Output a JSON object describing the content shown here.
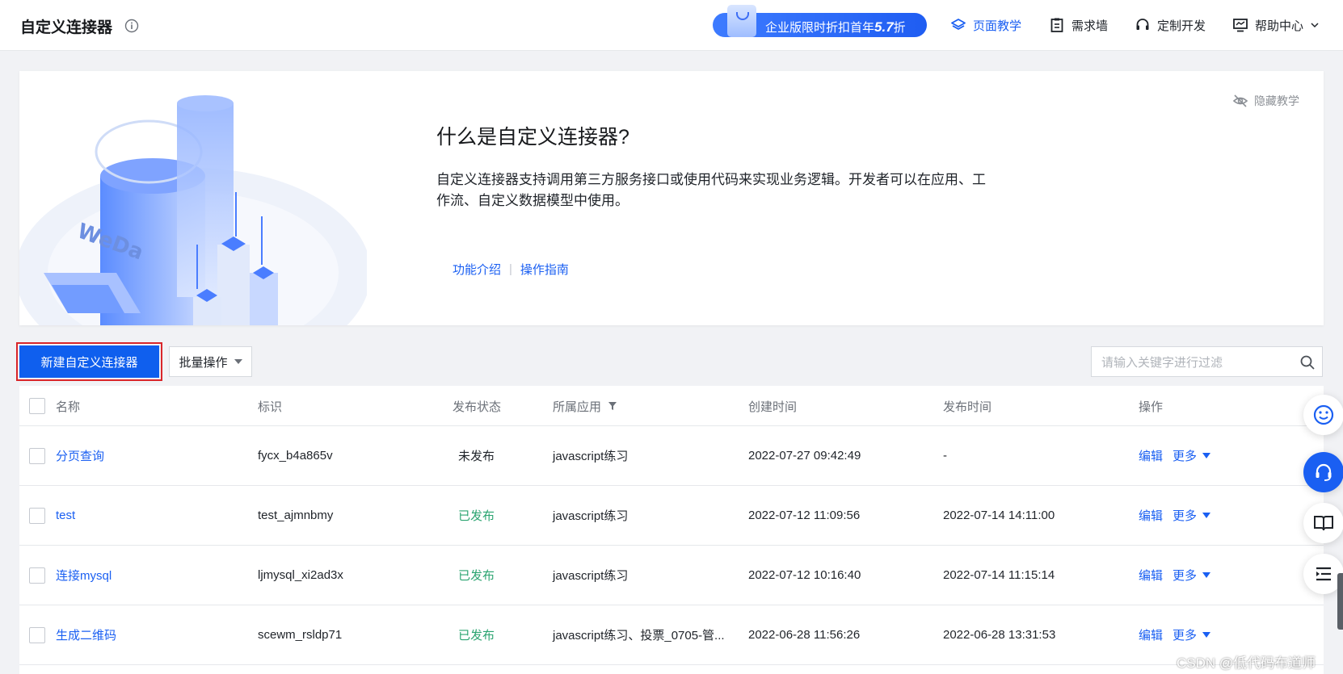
{
  "header": {
    "title": "自定义连接器",
    "promo": {
      "text": "企业版限时折扣首年",
      "number": "5.7",
      "suffix": "折"
    },
    "nav": [
      {
        "label": "页面教学",
        "icon": "layers-icon",
        "active": true
      },
      {
        "label": "需求墙",
        "icon": "clipboard-icon",
        "active": false
      },
      {
        "label": "定制开发",
        "icon": "headset-icon",
        "active": false
      },
      {
        "label": "帮助中心",
        "icon": "monitor-icon",
        "active": false
      }
    ]
  },
  "banner": {
    "illustration_text": "WeDa",
    "title": "什么是自定义连接器?",
    "description": "自定义连接器支持调用第三方服务接口或使用代码来实现业务逻辑。开发者可以在应用、工作流、自定义数据模型中使用。",
    "links": [
      "功能介绍",
      "操作指南"
    ],
    "hide_label": "隐藏教学"
  },
  "toolbar": {
    "create_label": "新建自定义连接器",
    "batch_label": "批量操作",
    "search_placeholder": "请输入关键字进行过滤"
  },
  "table": {
    "columns": [
      "名称",
      "标识",
      "发布状态",
      "所属应用",
      "创建时间",
      "发布时间",
      "操作"
    ],
    "rows": [
      {
        "name": "分页查询",
        "id": "fycx_b4a865v",
        "status": "未发布",
        "status_type": "unpublished",
        "app": "javascript练习",
        "created": "2022-07-27 09:42:49",
        "published": "-",
        "edit": "编辑",
        "more": "更多"
      },
      {
        "name": "test",
        "id": "test_ajmnbmy",
        "status": "已发布",
        "status_type": "published",
        "app": "javascript练习",
        "created": "2022-07-12 11:09:56",
        "published": "2022-07-14 14:11:00",
        "edit": "编辑",
        "more": "更多"
      },
      {
        "name": "连接mysql",
        "id": "ljmysql_xi2ad3x",
        "status": "已发布",
        "status_type": "published",
        "app": "javascript练习",
        "created": "2022-07-12 10:16:40",
        "published": "2022-07-14 11:15:14",
        "edit": "编辑",
        "more": "更多"
      },
      {
        "name": "生成二维码",
        "id": "scewm_rsldp71",
        "status": "已发布",
        "status_type": "published",
        "app": "javascript练习、投票_0705-管...",
        "created": "2022-06-28 11:56:26",
        "published": "2022-06-28 13:31:53",
        "edit": "编辑",
        "more": "更多"
      }
    ]
  },
  "side_buttons": [
    "smiley-icon",
    "headset-icon",
    "book-icon",
    "list-icon"
  ],
  "watermark": "CSDN @低代码布道师",
  "colors": {
    "primary": "#1a5ff2",
    "published": "#2ba471",
    "highlight_border": "#d9262a",
    "background": "#f1f2f5"
  }
}
